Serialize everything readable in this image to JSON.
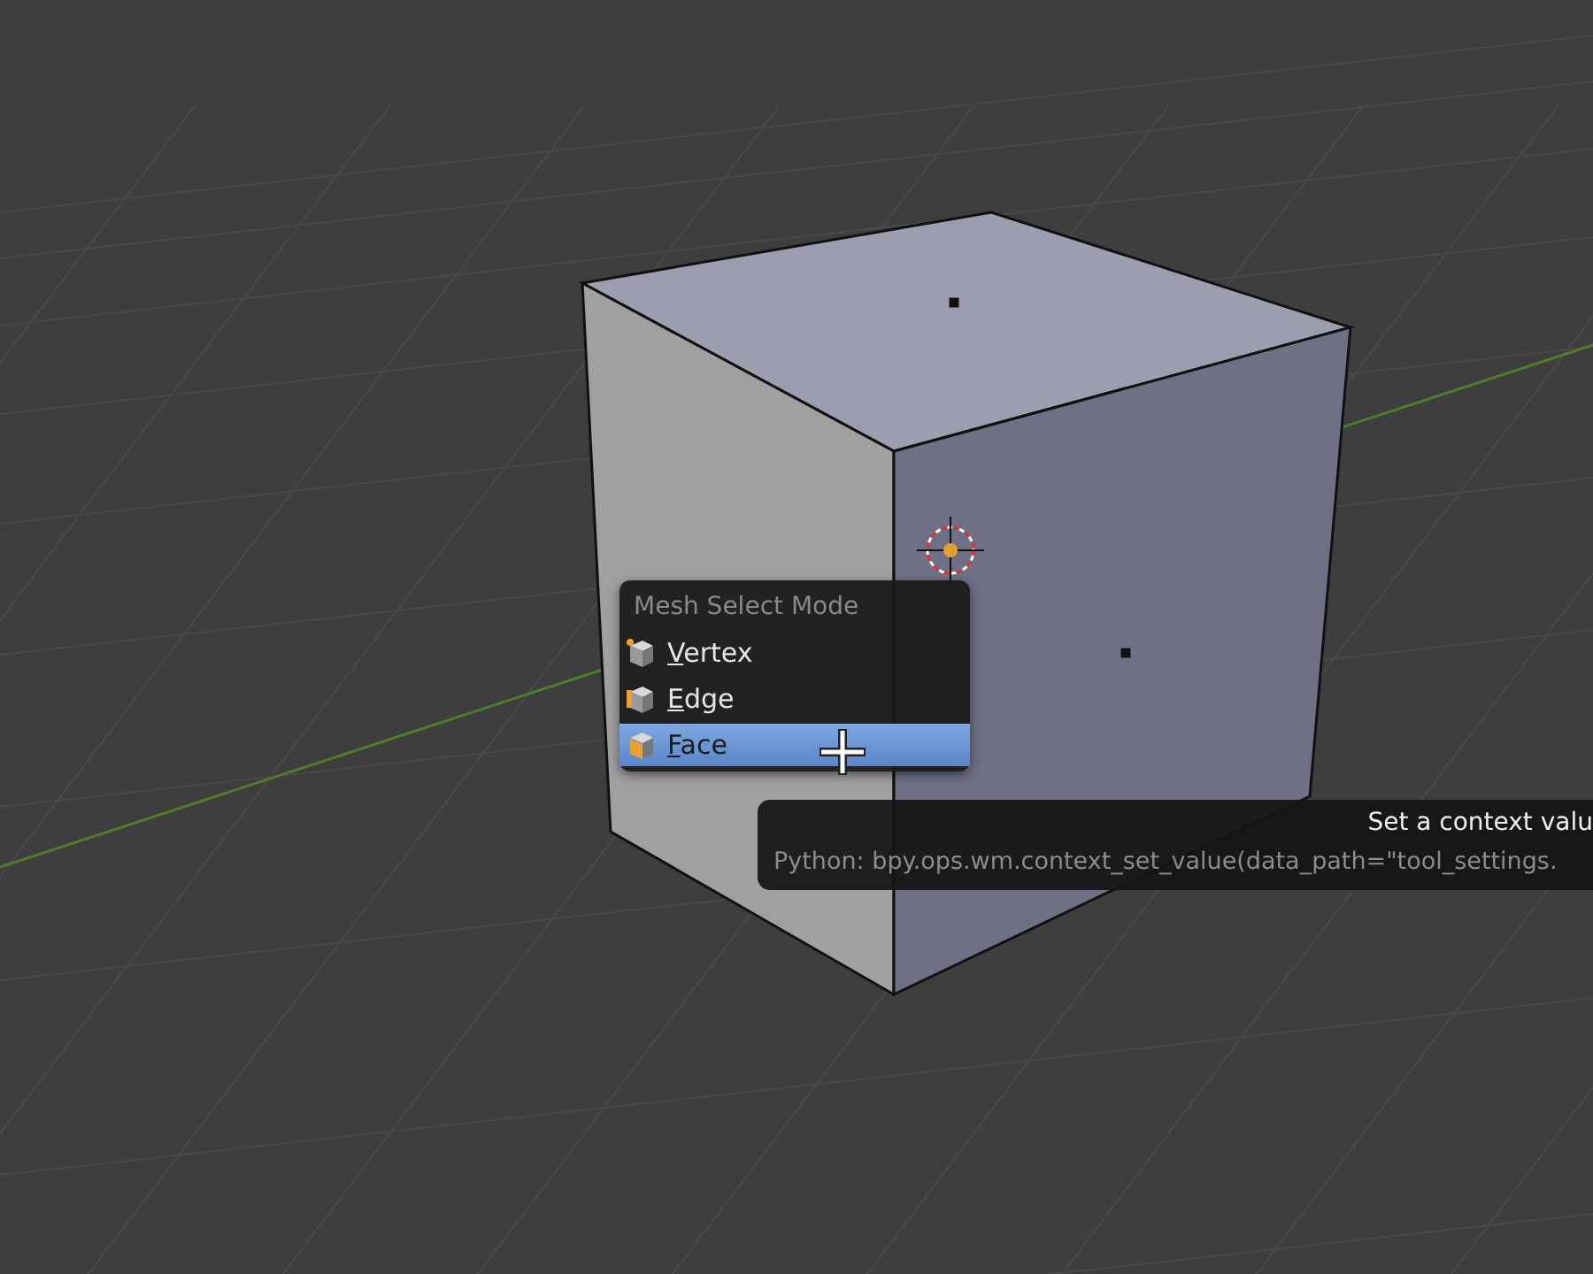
{
  "menu": {
    "title": "Mesh Select Mode",
    "items": [
      {
        "label": "Vertex",
        "kind": "vertex",
        "selected": false
      },
      {
        "label": "Edge",
        "kind": "edge",
        "selected": false
      },
      {
        "label": "Face",
        "kind": "face",
        "selected": true
      }
    ]
  },
  "tooltip": {
    "title": "Set a context valu",
    "python": "Python: bpy.ops.wm.context_set_value(data_path=\"tool_settings."
  }
}
